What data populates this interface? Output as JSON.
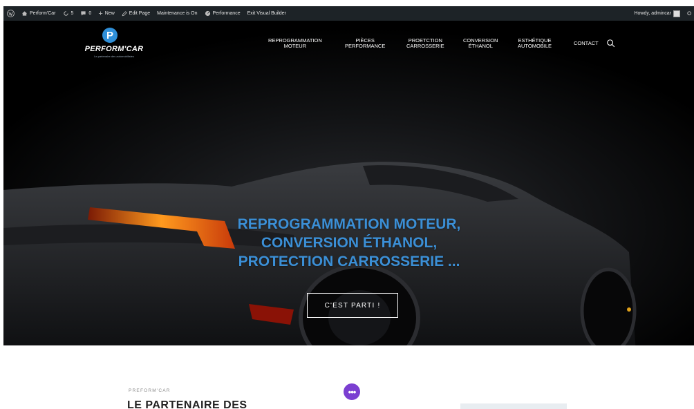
{
  "adminbar": {
    "site_name": "Perform'Car",
    "updates_count": "5",
    "comments_count": "0",
    "new_label": "New",
    "edit_page_label": "Edit Page",
    "maintenance_label": "Maintenance is On",
    "performance_label": "Performance",
    "exit_builder_label": "Exit Visual Builder",
    "howdy_label": "Howdy, admincar"
  },
  "logo": {
    "mark": "P",
    "name": "PERFORM'CAR",
    "tagline": "Le partenaire des automobilistes",
    "brand_color": "#2f8fd8"
  },
  "nav": {
    "items": [
      "REPROGRAMMATION\nMOTEUR",
      "PIÈCES\nPERFORMANCE",
      "PROETCTION\nCARROSSERIE",
      "CONVERSION\nÉTHANOL",
      "ESTHÉTIQUE\nAUTOMOBILE",
      "CONTACT"
    ]
  },
  "hero": {
    "headline_lines": [
      "REPROGRAMMATION MOTEUR,",
      "CONVERSION ÉTHANOL,",
      "PROTECTION CARROSSERIE ..."
    ],
    "headline_color": "#3b8fd6",
    "cta_label": "C'EST PARTI !"
  },
  "section": {
    "eyebrow": "PREFORM'CAR",
    "title": "LE PARTENAIRE DES"
  },
  "fab_color": "#7b3fd1"
}
